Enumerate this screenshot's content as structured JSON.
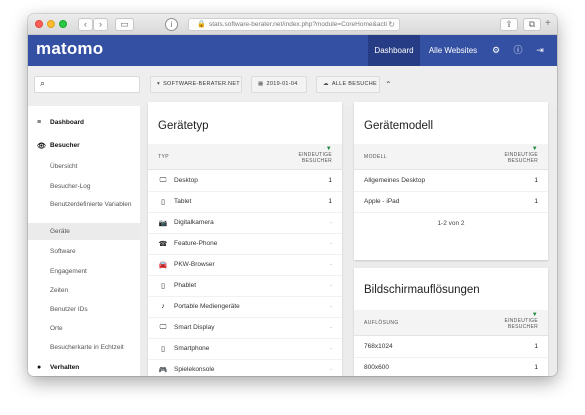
{
  "browser": {
    "url": "stats.software-berater.net/index.php?module=CoreHome&acti"
  },
  "header": {
    "logo": "matomo",
    "nav": [
      "Dashboard",
      "Alle Websites"
    ],
    "icons": [
      "gear-icon",
      "info-icon",
      "logout-icon"
    ]
  },
  "controls": {
    "search_placeholder": "",
    "site_selector": "SOFTWARE-BERATER.NET",
    "date_selector": "2019-01-04",
    "segment_selector": "ALLE BESUCHE"
  },
  "menu": {
    "dashboard": "Dashboard",
    "visitors_section": "Besucher",
    "visitors_items": [
      "Übersicht",
      "Besucher-Log",
      "Benutzerdefinierte Variablen",
      "Geräte",
      "Software",
      "Engagement",
      "Zeiten",
      "Benutzer IDs",
      "Orte",
      "Besucherkarte in Echtzeit"
    ],
    "behavior_section": "Verhalten"
  },
  "devices_card": {
    "title": "Gerätetyp",
    "col_type": "TYP",
    "col_visitors_1": "EINDEUTIGE",
    "col_visitors_2": "BESUCHER",
    "rows": [
      {
        "label": "Desktop",
        "value": "1",
        "icon": "desktop-icon"
      },
      {
        "label": "Tablet",
        "value": "1",
        "icon": "tablet-icon"
      },
      {
        "label": "Digitalkamera",
        "value": "-",
        "icon": "camera-icon"
      },
      {
        "label": "Feature-Phone",
        "value": "-",
        "icon": "phone-icon"
      },
      {
        "label": "PKW-Browser",
        "value": "-",
        "icon": "car-icon"
      },
      {
        "label": "Phablet",
        "value": "-",
        "icon": "phablet-icon"
      },
      {
        "label": "Portable Mediengeräte",
        "value": "-",
        "icon": "music-note-icon"
      },
      {
        "label": "Smart Display",
        "value": "-",
        "icon": "monitor-icon"
      },
      {
        "label": "Smartphone",
        "value": "-",
        "icon": "smartphone-icon"
      },
      {
        "label": "Spielekonsole",
        "value": "-",
        "icon": "gamepad-icon"
      }
    ]
  },
  "model_card": {
    "title": "Gerätemodell",
    "col_model": "MODELL",
    "col_visitors_1": "EINDEUTIGE",
    "col_visitors_2": "BESUCHER",
    "rows": [
      {
        "label": "Allgemeines Desktop",
        "value": "1"
      },
      {
        "label": "Apple - iPad",
        "value": "1"
      }
    ],
    "pager": "1-2 von 2"
  },
  "resolution_card": {
    "title": "Bildschirmauflösungen",
    "col_res": "AUFLÖSUNG",
    "col_visitors_1": "EINDEUTIGE",
    "col_visitors_2": "BESUCHER",
    "rows": [
      {
        "label": "768x1024",
        "value": "1"
      },
      {
        "label": "800x600",
        "value": "1"
      }
    ]
  },
  "colors": {
    "brand_header": "#3450a3",
    "header_active": "#263c84",
    "sort_arrow": "#1b8a3e"
  }
}
